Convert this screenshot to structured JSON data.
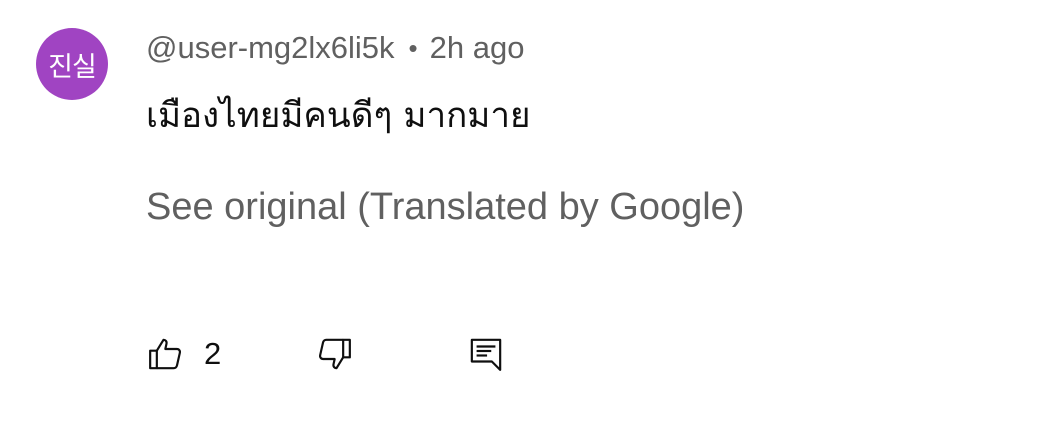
{
  "comment": {
    "avatar_text": "진실",
    "avatar_color": "#a044c2",
    "author": "@user-mg2lx6li5k",
    "separator": "•",
    "time": "2h ago",
    "text": "เมืองไทยมีคนดีๆ มากมาย",
    "translate_link": "See original (Translated by Google)",
    "like_count": "2"
  },
  "icons": {
    "like": "thumbs-up-icon",
    "dislike": "thumbs-down-icon",
    "reply": "reply-comment-icon"
  },
  "colors": {
    "secondary_text": "#606060",
    "primary_text": "#0f0f0f",
    "background": "#ffffff"
  }
}
